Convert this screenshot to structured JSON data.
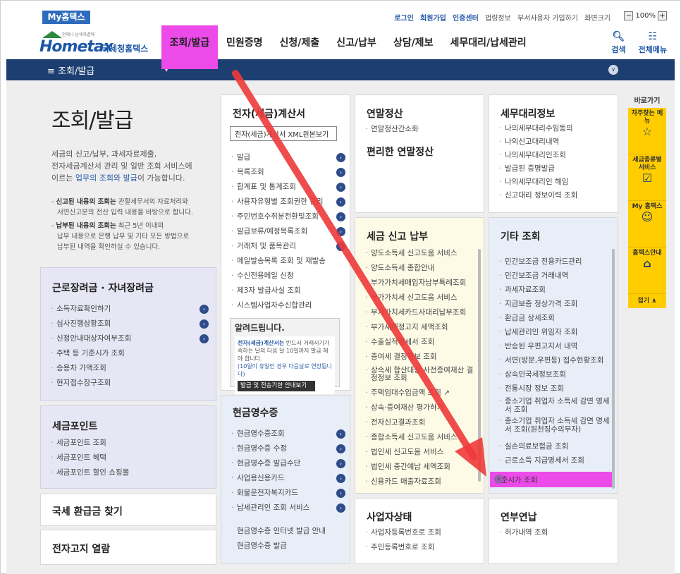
{
  "topbar": {
    "my_tab": "My홈택스",
    "links": [
      "로그인",
      "회원가입",
      "인증센터"
    ],
    "sublinks": [
      "법령정보",
      "부서사용자 가입하기",
      "화면크기"
    ],
    "zoom": "100%"
  },
  "header": {
    "logo_brand": "Hometax",
    "logo_sub": "국세청홈택스",
    "logo_tiny": "언제나 납세자곁에",
    "gnb": [
      "조회/발급",
      "민원증명",
      "신청/제출",
      "신고/납부",
      "상담/제보",
      "세무대리/납세관리"
    ],
    "search_label": "검색",
    "menu_label": "전체메뉴"
  },
  "navbar": {
    "label": "조회/발급"
  },
  "intro": {
    "title": "조회/발급",
    "desc1": "세금의 신고/납부, 과세자료제출,",
    "desc2": "전자세금계산서 관리 및 일반 조회 서비스에",
    "desc3_pre": "이르는 ",
    "desc3_hl": "업무의 조회와 발급",
    "desc3_post": "이 가능합니다.",
    "note1a": "신고된 내용의 조회는",
    "note1b": " 관할세무서의 자료처리와",
    "note1c": "서면신고분의 전산 입력 내용을 바탕으로 합니다.",
    "note2a": "납부된 내용의 조회는",
    "note2b": " 최근 5년 이내의",
    "note2c": "납부 내용으로 은행 납부 및 기타 모든 방법으로",
    "note2d": "납부된 내역을 확인하실 수 있습니다."
  },
  "panels": {
    "labor": {
      "title": "근로장려금 · 자녀장려금",
      "items": [
        "소득자료확인하기",
        "심사진행상황조회",
        "신청안내대상자여부조회",
        "주택 등 기준시가 조회",
        "승용차 가액조회",
        "현지접수장구조회"
      ]
    },
    "points": {
      "title": "세금포인트",
      "items": [
        "세금포인트 조회",
        "세금포인트 혜택",
        "세금포인트 할인 쇼핑몰"
      ]
    },
    "refund": {
      "title": "국세 환급금 찾기"
    },
    "enotice": {
      "title": "전자고지 열람"
    },
    "einvoice": {
      "title": "전자(세금)계산서",
      "btn": "전자(세금)계산서 XML원본보기",
      "items": [
        "발급",
        "목록조회",
        "합계표 및 통계조회",
        "사용자유형별 조회권한 관리",
        "주민번호수취분전환및조회",
        "발급보류/예정목록조회",
        "거래처 및 품목관리",
        "메일발송목록 조회 및 재발송",
        "수신전용메일 신청",
        "제3자 발급사실 조회",
        "시스템사업자수신합관리"
      ]
    },
    "notice": {
      "title": "알려드립니다.",
      "text1": "전자(세금)계산서는",
      "text2": " 반드시 거래시기가 속하는 달의 다음 달 10일까지 발급",
      "text3": "해야 합니다.",
      "text4": "(10일이 휴일인 경우 다음날로 연장됩니다)",
      "btn": "발급 및 전송기한 안내보기"
    },
    "cash": {
      "title": "현금영수증",
      "items": [
        "현금영수증조회",
        "현금영수증 수정",
        "현금영수증 발급수단",
        "사업용신용카드",
        "화물운전자복지카드",
        "납세관리인 조회 서비스"
      ],
      "extra": [
        "현금영수증 인터넷 발급 안내",
        "현금영수증 발급"
      ]
    },
    "yearend": {
      "title": "연말정산",
      "items": [
        "연말정산간소화"
      ],
      "sub": "편리한 연말정산"
    },
    "filing": {
      "title": "세금 신고 납부",
      "items": [
        "양도소득세 신고도움 서비스",
        "양도소득세 종합안내",
        "부가가치세매입자납부특례조회",
        "부가가치세 신고도움 서비스",
        "부가가치세카드사대리납부조회",
        "부가세예정고지 세액조회",
        "수출실적명세서 조회",
        "증여세 결정정보 조회",
        "상속세 합산대상 사전증여재산 결정정보 조회",
        "주택임대수입금액 조회",
        "상속·증여재산 평가하기",
        "전자신고결과조회",
        "종합소득세 신고도움 서비스",
        "법인세 신고도움 서비스",
        "법인세 중간예납 세액조회",
        "신용카드 매출자료조회"
      ]
    },
    "bizstatus": {
      "title": "사업자상태",
      "items": [
        "사업자등록번호로 조회",
        "주민등록번호로 조회"
      ]
    },
    "agent": {
      "title": "세무대리정보",
      "items": [
        "나의세무대리수임동의",
        "나의신고대리내역",
        "나의세무대리인조회",
        "발급된 증명발급",
        "나의세무대리인 해임",
        "신고대리 정보이력 조회"
      ]
    },
    "other": {
      "title": "기타 조회",
      "items": [
        "민간보조금 전용카드관리",
        "민간보조금 거래내역",
        "과세자료조회",
        "지급보증 정상가격 조회",
        "환급금 상세조회",
        "납세관리인 위임자 조회",
        "반송된 우편고지서 내역",
        "서면(방문,우편등) 접수현황조회",
        "상속인국세정보조회",
        "전통시장 정보 조회",
        "중소기업 취업자 소득세 감면 명세서 조회",
        "중소기업 취업자 소득세 감면 명세서 조회(원천징수의무자)",
        "실손의료보험금 조회",
        "근로소득 지급명세서 조회"
      ],
      "highlight": "기준시가 조회"
    },
    "pension": {
      "title": "연부연납",
      "items": [
        "허가내역 조회"
      ]
    }
  },
  "sidebar": {
    "title": "바로가기",
    "items": [
      "자주찾는 메뉴",
      "세금종류별 서비스",
      "My 홈택스",
      "홈택스안내"
    ],
    "close": "접기"
  },
  "colors": {
    "highlight": "#ec4bea",
    "nav": "#1c3e70",
    "accent": "#ffcd00",
    "arrow": "#ee3a3a"
  }
}
